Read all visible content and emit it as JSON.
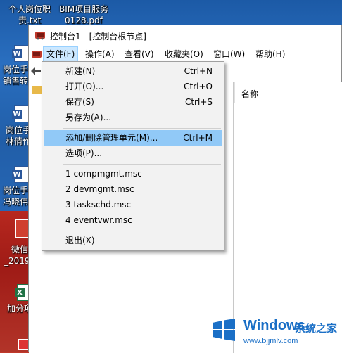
{
  "desktop": {
    "top_labels": [
      "个人岗位职",
      "BIM项目服务"
    ],
    "top_sub": [
      "责.txt",
      "0128.pdf"
    ],
    "left_labels": [
      "岗位手",
      "销售转",
      "岗位手",
      "林倩作",
      "岗位手",
      "冯晓伟",
      "微信",
      "_2019",
      "加分项"
    ]
  },
  "window": {
    "title": "控制台1 - [控制台根节点]",
    "menu": [
      "文件(F)",
      "操作(A)",
      "查看(V)",
      "收藏夹(O)",
      "窗口(W)",
      "帮助(H)"
    ],
    "right_header": "名称"
  },
  "dropdown": {
    "items": [
      {
        "label": "新建(N)",
        "shortcut": "Ctrl+N"
      },
      {
        "label": "打开(O)...",
        "shortcut": "Ctrl+O"
      },
      {
        "label": "保存(S)",
        "shortcut": "Ctrl+S"
      },
      {
        "label": "另存为(A)...",
        "shortcut": ""
      },
      {
        "label": "添加/删除管理单元(M)...",
        "shortcut": "Ctrl+M"
      },
      {
        "label": "选项(P)...",
        "shortcut": ""
      },
      {
        "label": "1 compmgmt.msc",
        "shortcut": ""
      },
      {
        "label": "2 devmgmt.msc",
        "shortcut": ""
      },
      {
        "label": "3 taskschd.msc",
        "shortcut": ""
      },
      {
        "label": "4 eventvwr.msc",
        "shortcut": ""
      },
      {
        "label": "退出(X)",
        "shortcut": ""
      }
    ],
    "highlight_index": 4
  },
  "watermark": {
    "brand": "Windows",
    "brand_cn": "系统之家",
    "url": "www.bjjmlv.com"
  },
  "colors": {
    "menu_active": "#cce8ff",
    "menu_highlight": "#91c9f7",
    "watermark_blue": "#1a6fc6"
  }
}
